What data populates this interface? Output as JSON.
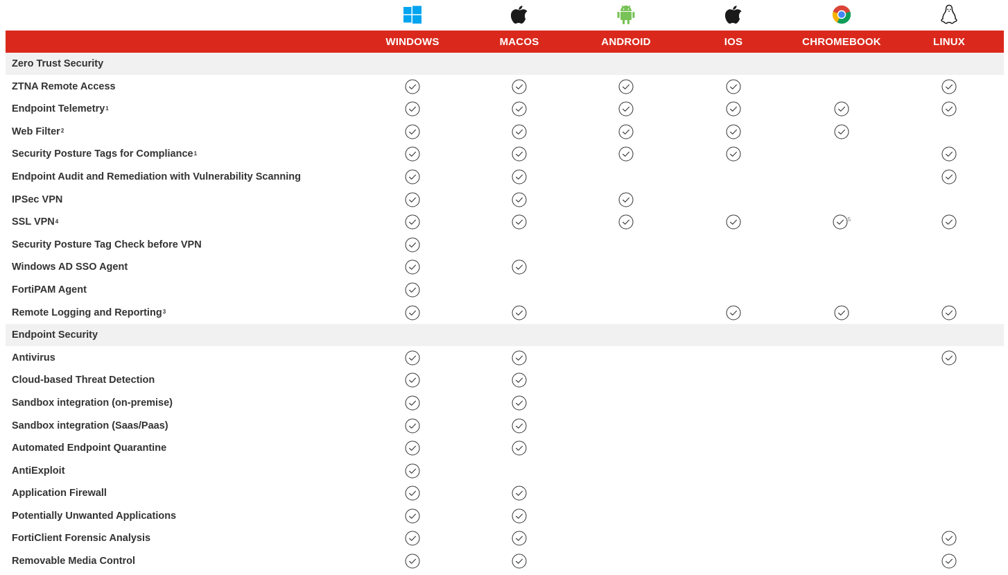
{
  "platforms": [
    {
      "key": "windows",
      "label": "WINDOWS",
      "icon": "windows-icon",
      "color": "#00a4ef"
    },
    {
      "key": "macos",
      "label": "MACOS",
      "icon": "apple-icon",
      "color": "#1a1a1a"
    },
    {
      "key": "android",
      "label": "ANDROID",
      "icon": "android-icon",
      "color": "#78c257"
    },
    {
      "key": "ios",
      "label": "IOS",
      "icon": "apple-icon",
      "color": "#1a1a1a"
    },
    {
      "key": "chromebook",
      "label": "CHROMEBOOK",
      "icon": "chrome-icon",
      "color": "#db4437"
    },
    {
      "key": "linux",
      "label": "LINUX",
      "icon": "linux-tux-icon",
      "color": "#1a1a1a"
    }
  ],
  "colors": {
    "header_bg": "#da291c",
    "section_bg": "#f1f1f1",
    "check": "#333333"
  },
  "rows": [
    {
      "type": "section",
      "label": "Zero Trust Security"
    },
    {
      "type": "feature",
      "label": "ZTNA Remote Access",
      "sup": "",
      "checks": [
        true,
        true,
        true,
        true,
        false,
        true
      ]
    },
    {
      "type": "feature",
      "label": "Endpoint Telemetry",
      "sup": "1",
      "checks": [
        true,
        true,
        true,
        true,
        true,
        true
      ]
    },
    {
      "type": "feature",
      "label": "Web Filter",
      "sup": "2",
      "checks": [
        true,
        true,
        true,
        true,
        true,
        false
      ]
    },
    {
      "type": "feature",
      "label": "Security Posture Tags for Compliance",
      "sup": "1",
      "checks": [
        true,
        true,
        true,
        true,
        false,
        true
      ]
    },
    {
      "type": "feature",
      "label": "Endpoint Audit and Remediation with Vulnerability Scanning",
      "sup": "",
      "checks": [
        true,
        true,
        false,
        false,
        false,
        true
      ]
    },
    {
      "type": "feature",
      "label": "IPSec VPN",
      "sup": "",
      "checks": [
        true,
        true,
        true,
        false,
        false,
        false
      ]
    },
    {
      "type": "feature",
      "label": "SSL VPN",
      "sup": "4",
      "checks": [
        true,
        true,
        true,
        true,
        true,
        true
      ],
      "cell_notes": [
        "",
        "",
        "",
        "",
        "5",
        ""
      ]
    },
    {
      "type": "feature",
      "label": "Security Posture Tag Check before VPN",
      "sup": "",
      "checks": [
        true,
        false,
        false,
        false,
        false,
        false
      ]
    },
    {
      "type": "feature",
      "label": "Windows AD SSO Agent",
      "sup": "",
      "checks": [
        true,
        true,
        false,
        false,
        false,
        false
      ]
    },
    {
      "type": "feature",
      "label": "FortiPAM Agent",
      "sup": "",
      "checks": [
        true,
        false,
        false,
        false,
        false,
        false
      ]
    },
    {
      "type": "feature",
      "label": "Remote Logging and Reporting",
      "sup": "3",
      "checks": [
        true,
        true,
        false,
        true,
        true,
        true
      ]
    },
    {
      "type": "section",
      "label": "Endpoint Security"
    },
    {
      "type": "feature",
      "label": "Antivirus",
      "sup": "",
      "checks": [
        true,
        true,
        false,
        false,
        false,
        true
      ]
    },
    {
      "type": "feature",
      "label": "Cloud-based Threat Detection",
      "sup": "",
      "checks": [
        true,
        true,
        false,
        false,
        false,
        false
      ]
    },
    {
      "type": "feature",
      "label": "Sandbox integration (on-premise)",
      "sup": "",
      "checks": [
        true,
        true,
        false,
        false,
        false,
        false
      ]
    },
    {
      "type": "feature",
      "label": "Sandbox integration (Saas/Paas)",
      "sup": "",
      "checks": [
        true,
        true,
        false,
        false,
        false,
        false
      ]
    },
    {
      "type": "feature",
      "label": "Automated Endpoint Quarantine",
      "sup": "",
      "checks": [
        true,
        true,
        false,
        false,
        false,
        false
      ]
    },
    {
      "type": "feature",
      "label": "AntiExploit",
      "sup": "",
      "checks": [
        true,
        false,
        false,
        false,
        false,
        false
      ]
    },
    {
      "type": "feature",
      "label": "Application Firewall",
      "sup": "",
      "checks": [
        true,
        true,
        false,
        false,
        false,
        false
      ]
    },
    {
      "type": "feature",
      "label": "Potentially Unwanted Applications",
      "sup": "",
      "checks": [
        true,
        true,
        false,
        false,
        false,
        false
      ]
    },
    {
      "type": "feature",
      "label": "FortiClient Forensic Analysis",
      "sup": "",
      "checks": [
        true,
        true,
        false,
        false,
        false,
        true
      ]
    },
    {
      "type": "feature",
      "label": "Removable Media Control",
      "sup": "",
      "checks": [
        true,
        true,
        false,
        false,
        false,
        true
      ]
    }
  ]
}
